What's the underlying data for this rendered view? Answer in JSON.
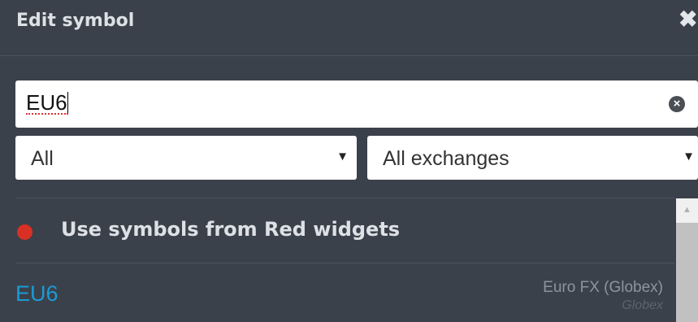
{
  "dialog": {
    "title": "Edit symbol",
    "close_icon": "close-icon"
  },
  "search": {
    "value": "EU6",
    "clear_icon": "clear-circle-icon"
  },
  "filters": {
    "type": "All",
    "exchange": "All exchanges"
  },
  "widget_option": {
    "label": "Use symbols from Red widgets",
    "dot_color": "#d93025"
  },
  "results": [
    {
      "symbol": "EU6",
      "description": "Euro FX (Globex)",
      "exchange": "Globex"
    }
  ],
  "colors": {
    "background": "#3b414b",
    "symbol_accent": "#1a9bd7"
  }
}
